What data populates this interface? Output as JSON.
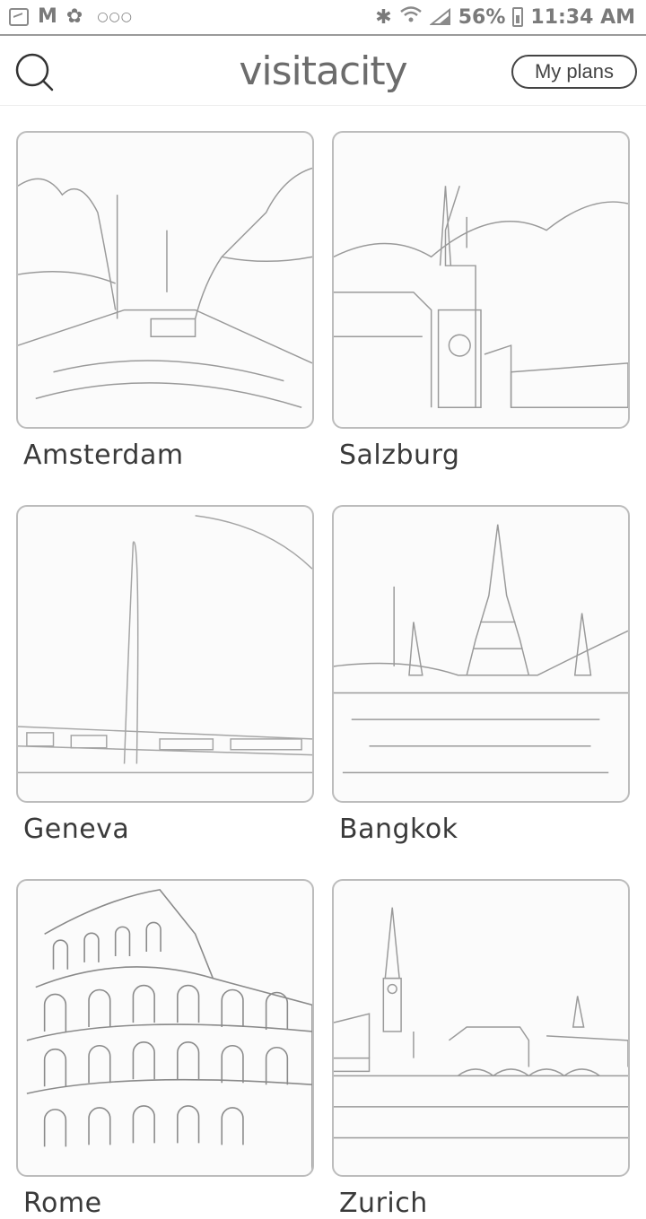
{
  "status_bar": {
    "battery": "56%",
    "time": "11:34 AM",
    "icons": [
      "gallery-icon",
      "gmail-icon",
      "pinwheel-icon",
      "more-dots-icon",
      "bluetooth-icon",
      "wifi-icon",
      "signal-icon",
      "battery-icon"
    ]
  },
  "header": {
    "logo": "visitacity",
    "plans_label": "My plans",
    "search_icon": "search-icon"
  },
  "cities": [
    {
      "name": "Amsterdam",
      "image": "canal-icon"
    },
    {
      "name": "Salzburg",
      "image": "church-town-icon"
    },
    {
      "name": "Geneva",
      "image": "lake-fountain-icon"
    },
    {
      "name": "Bangkok",
      "image": "temple-river-icon"
    },
    {
      "name": "Rome",
      "image": "colosseum-icon"
    },
    {
      "name": "Zurich",
      "image": "river-bridge-icon"
    }
  ],
  "colors": {
    "border": "#bcbcbc",
    "text": "#3a3a3a",
    "logo": "#6c6c6c"
  }
}
